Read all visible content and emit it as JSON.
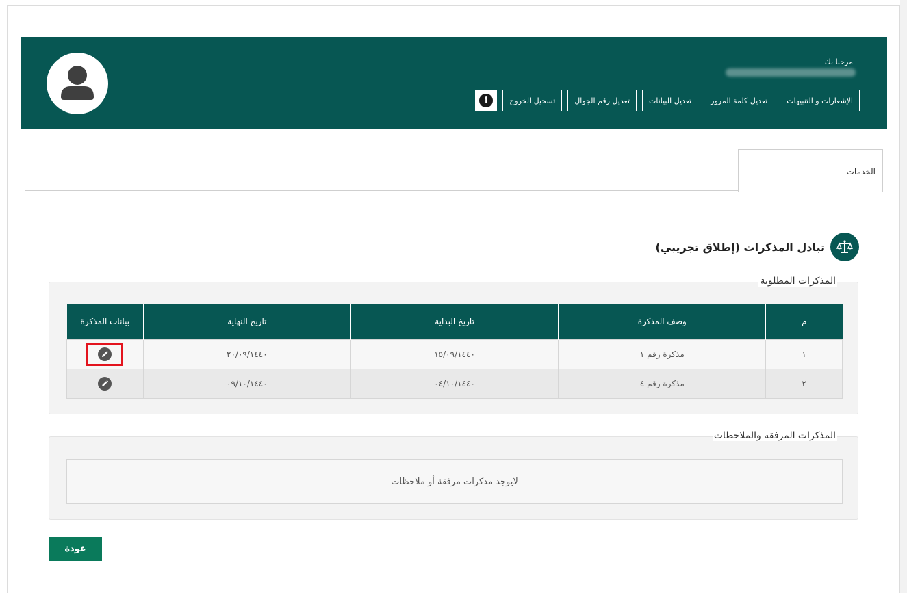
{
  "header": {
    "welcome": "مرحبا بك",
    "nav": [
      {
        "id": "notifications",
        "label": "الإشعارات و التنبيهات"
      },
      {
        "id": "change-password",
        "label": "تعديل كلمة المرور"
      },
      {
        "id": "edit-profile",
        "label": "تعديل البيانات"
      },
      {
        "id": "edit-mobile",
        "label": "تعديل رقم الجوال"
      },
      {
        "id": "logout",
        "label": "تسجيل الخروج"
      }
    ],
    "info_icon": "i"
  },
  "tab": {
    "label": "الخدمات"
  },
  "page": {
    "title": "تبادل المذكرات (إطلاق تجريبي)"
  },
  "required_memos": {
    "legend": "المذكرات المطلوبة",
    "columns": [
      "م",
      "وصف المذكرة",
      "تاريخ البداية",
      "تاريخ النهاية",
      "بيانات المذكرة"
    ],
    "rows": [
      {
        "num": "١",
        "description": "مذكرة رقم ١",
        "start": "١٥/٠٩/١٤٤٠",
        "end": "٢٠/٠٩/١٤٤٠"
      },
      {
        "num": "٢",
        "description": "مذكرة رقم ٤",
        "start": "٠٤/١٠/١٤٤٠",
        "end": "٠٩/١٠/١٤٤٠"
      }
    ]
  },
  "attached_memos": {
    "legend": "المذكرات المرفقة والملاحظات",
    "empty_text": "لايوجد مذكرات مرفقة أو ملاحظات"
  },
  "back_label": "عودة",
  "colors": {
    "primary": "#075753",
    "button": "#0a7a5b",
    "highlight": "#e3141e"
  }
}
